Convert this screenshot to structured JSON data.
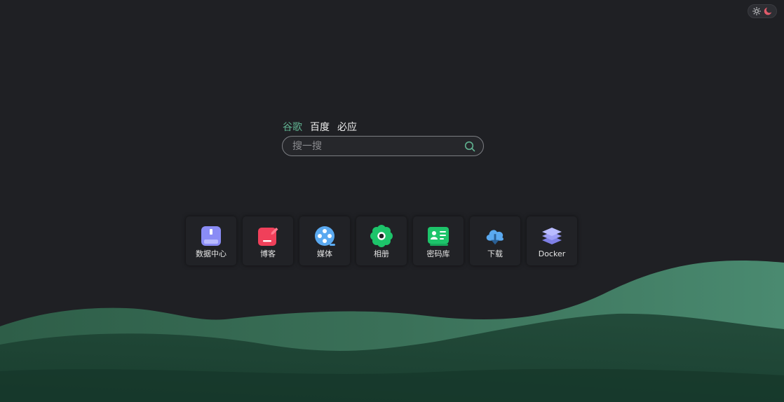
{
  "theme_switch": {
    "light_icon": "sun-icon",
    "dark_icon": "moon-icon",
    "moon_color": "#e05b6a"
  },
  "search": {
    "engines": [
      {
        "label": "谷歌",
        "active": true
      },
      {
        "label": "百度",
        "active": false
      },
      {
        "label": "必应",
        "active": false
      }
    ],
    "placeholder": "搜一搜",
    "button_icon": "search-icon",
    "accent": "#5fb08f"
  },
  "apps": [
    {
      "label": "数据中心",
      "icon": "database-icon",
      "color": "#8a8cf5"
    },
    {
      "label": "博客",
      "icon": "edit-icon",
      "color": "#f0405a"
    },
    {
      "label": "媒体",
      "icon": "film-reel-icon",
      "color": "#5aa9f0"
    },
    {
      "label": "相册",
      "icon": "flower-icon",
      "color": "#1dc46a"
    },
    {
      "label": "密码库",
      "icon": "id-card-icon",
      "color": "#1dc46a"
    },
    {
      "label": "下载",
      "icon": "cloud-download-icon",
      "color": "#5aa9f0"
    },
    {
      "label": "Docker",
      "icon": "layers-icon",
      "color": "#8a8cf5"
    }
  ]
}
